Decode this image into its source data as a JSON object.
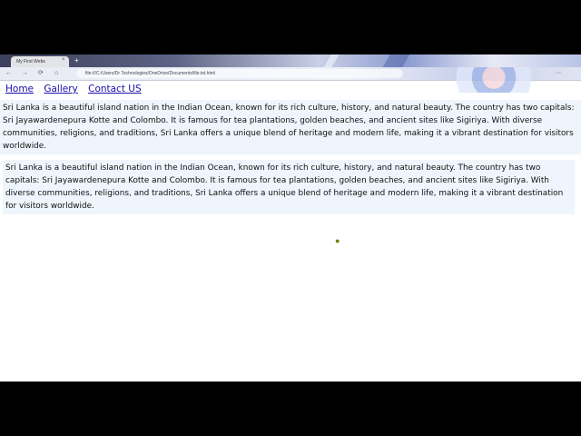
{
  "browser": {
    "tab_title": "My First Webs",
    "tab_close": "×",
    "new_tab": "+",
    "url": "file:///C:/Users/Dr Technologies/OneDrive/Documents/file.txt.html",
    "back_icon": "←",
    "forward_icon": "→",
    "reload_icon": "⟳",
    "home_icon": "⌂",
    "menu_icon": "⋯"
  },
  "nav": {
    "home": "Home",
    "gallery": "Gallery",
    "contact": "Contact US"
  },
  "content": {
    "paragraph1": "Sri Lanka is a beautiful island nation in the Indian Ocean, known for its rich culture, history, and natural beauty. The country has two capitals: Sri Jayawardenepura Kotte and Colombo. It is famous for tea plantations, golden beaches, and ancient sites like Sigiriya. With diverse communities, religions, and traditions, Sri Lanka offers a unique blend of heritage and modern life, making it a vibrant destination for visitors worldwide.",
    "paragraph2": "Sri Lanka is a beautiful island nation in the Indian Ocean, known for its rich culture, history, and natural beauty. The country has two capitals: Sri Jayawardenepura Kotte and Colombo. It is famous for tea plantations, golden beaches, and ancient sites like Sigiriya. With diverse communities, religions, and traditions, Sri Lanka offers a unique blend of heritage and modern life, making it a vibrant destination for visitors worldwide."
  },
  "colors": {
    "link": "#1a0dab",
    "paragraph_bg": "#eef5fc"
  }
}
